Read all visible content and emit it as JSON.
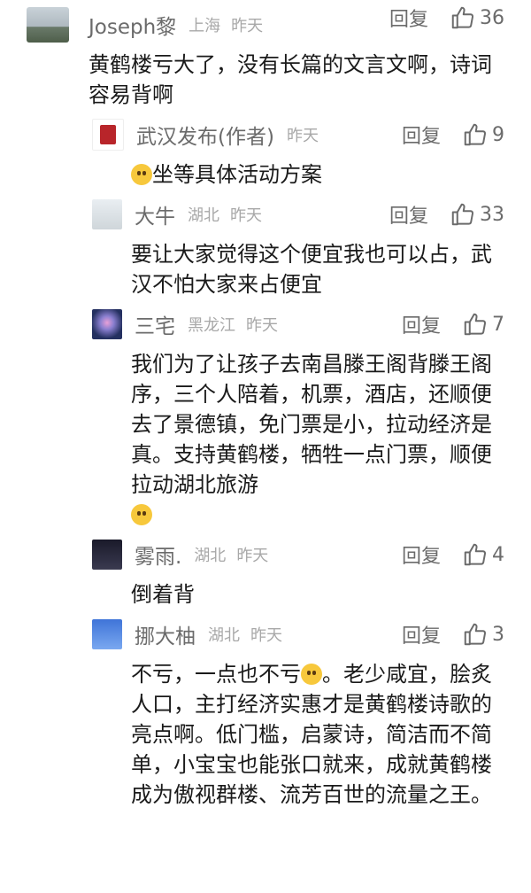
{
  "comments": [
    {
      "name": "Joseph黎",
      "location": "上海",
      "time": "昨天",
      "reply": "回复",
      "likes": "36",
      "text": "黄鹤楼亏大了，没有长篇的文言文啊，诗词容易背啊"
    }
  ],
  "replies": [
    {
      "name": "武汉发布(作者)",
      "location": "",
      "time": "昨天",
      "reply": "回复",
      "likes": "9",
      "text": "坐等具体活动方案"
    },
    {
      "name": "大牛",
      "location": "湖北",
      "time": "昨天",
      "reply": "回复",
      "likes": "33",
      "text": "要让大家觉得这个便宜我也可以占，武汉不怕大家来占便宜"
    },
    {
      "name": "三宅",
      "location": "黑龙江",
      "time": "昨天",
      "reply": "回复",
      "likes": "7",
      "text": "我们为了让孩子去南昌滕王阁背滕王阁序，三个人陪着，机票，酒店，还顺便去了景德镇，免门票是小，拉动经济是真。支持黄鹤楼，牺牲一点门票，顺便拉动湖北旅游"
    },
    {
      "name": "雾雨.",
      "location": "湖北",
      "time": "昨天",
      "reply": "回复",
      "likes": "4",
      "text": "倒着背"
    },
    {
      "name": "挪大柚",
      "location": "湖北",
      "time": "昨天",
      "reply": "回复",
      "likes": "3",
      "text_a": "不亏，一点也不亏",
      "text_b": "。老少咸宜，脍炙人口，主打经济实惠才是黄鹤楼诗歌的亮点啊。低门槛，启蒙诗，简洁而不简单，小宝宝也能张口就来，成就黄鹤楼成为傲视群楼、流芳百世的流量之王。"
    }
  ],
  "icons": {
    "like": "thumbs-up-icon",
    "emoji": "smile-emoji-icon"
  }
}
